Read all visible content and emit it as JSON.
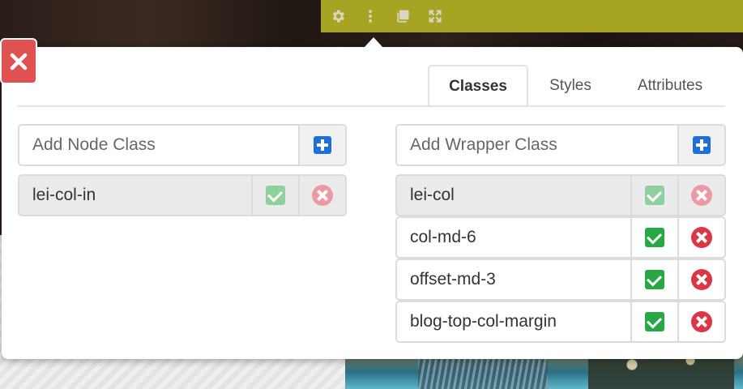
{
  "toolbar": {
    "icons": [
      "gear-icon",
      "more-vertical-icon",
      "copy-icon",
      "expand-icon"
    ]
  },
  "tabs": {
    "classes": "Classes",
    "styles": "Styles",
    "attributes": "Attributes"
  },
  "node": {
    "placeholder": "Add Node Class",
    "classes": [
      {
        "name": "lei-col-in",
        "locked": true
      }
    ]
  },
  "wrapper": {
    "placeholder": "Add Wrapper Class",
    "classes": [
      {
        "name": "lei-col",
        "locked": true
      },
      {
        "name": "col-md-6",
        "locked": false
      },
      {
        "name": "offset-md-3",
        "locked": false
      },
      {
        "name": "blog-top-col-margin",
        "locked": false
      }
    ]
  },
  "colors": {
    "toolbar": "#a7a323",
    "close": "#e05252",
    "add": "#1e6fd9",
    "check": "#28a745",
    "remove": "#dc3545"
  }
}
